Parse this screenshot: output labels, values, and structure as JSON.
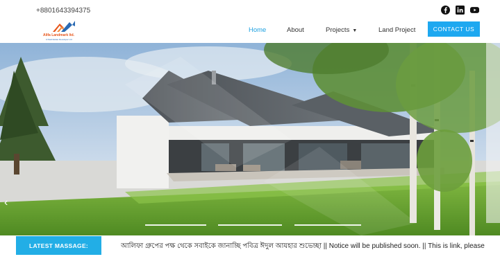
{
  "topbar": {
    "phone": "+8801643394375",
    "socials": [
      {
        "icon": "facebook-icon"
      },
      {
        "icon": "linkedin-icon"
      },
      {
        "icon": "youtube-icon"
      }
    ]
  },
  "logo": {
    "name": "Alifa Landmark ltd.",
    "tagline": "A Real Estate Developer Ltd"
  },
  "nav": {
    "items": [
      {
        "label": "Home",
        "active": true
      },
      {
        "label": "About",
        "active": false
      },
      {
        "label": "Projects",
        "active": false,
        "dropdown": true
      },
      {
        "label": "Land Project",
        "active": false
      }
    ],
    "cta": "CONTACT US"
  },
  "hero": {
    "prev_arrow": "‹"
  },
  "ticker": {
    "label": "LATEST MASSAGE:",
    "text": "আলিফা গ্রুপের পক্ষ থেকে সবাইকে জানাচ্ছি পবিত্র ঈদুল আযহার শুভেচ্ছা || Notice will be published soon. || This is link, please"
  },
  "colors": {
    "accent": "#1ea8f0",
    "logo_orange": "#e7561b",
    "logo_blue": "#2a6ab3"
  }
}
